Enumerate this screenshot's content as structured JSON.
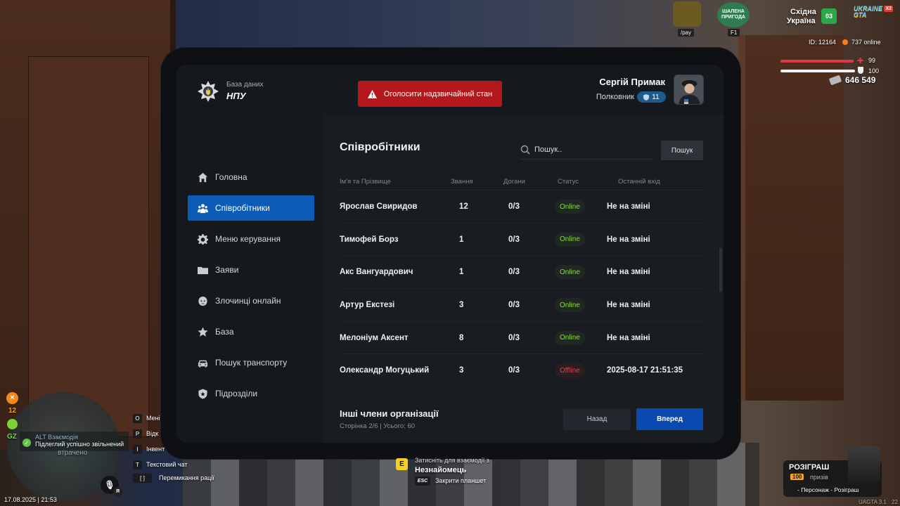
{
  "colors": {
    "accent": "#0a5cb7",
    "danger": "#b3191c",
    "online": "#8fd94a",
    "offline": "#e04349"
  },
  "header": {
    "db_subtitle": "База даних",
    "db_title": "НПУ",
    "emergency_label": "Оголосити надзвичайний стан",
    "user_name": "Сергій Примак",
    "user_rank": "Полковник",
    "rank_level": "11"
  },
  "sidebar": {
    "items": [
      {
        "label": "Головна",
        "icon": "home-icon"
      },
      {
        "label": "Співробітники",
        "icon": "users-icon",
        "active": true
      },
      {
        "label": "Меню керування",
        "icon": "gear-icon"
      },
      {
        "label": "Заяви",
        "icon": "folder-icon"
      },
      {
        "label": "Злочинці онлайн",
        "icon": "mask-icon"
      },
      {
        "label": "База",
        "icon": "star-icon"
      },
      {
        "label": "Пошук транспорту",
        "icon": "car-icon"
      },
      {
        "label": "Підрозділи",
        "icon": "shield-icon"
      }
    ]
  },
  "main": {
    "title": "Співробітники",
    "search_placeholder": "Пошук..",
    "search_button": "Пошук",
    "columns": [
      "Ім'я та Прізвище",
      "Звання",
      "Догани",
      "Статус",
      "Останній вхід"
    ],
    "rows": [
      {
        "name": "Ярослав Свиридов",
        "rank": "12",
        "reprimands": "0/3",
        "status": "Online",
        "last": "Не на зміні"
      },
      {
        "name": "Тимофей Борз",
        "rank": "1",
        "reprimands": "0/3",
        "status": "Online",
        "last": "Не на зміні"
      },
      {
        "name": "Акс Вангуардович",
        "rank": "1",
        "reprimands": "0/3",
        "status": "Online",
        "last": "Не на зміні"
      },
      {
        "name": "Артур Екстезі",
        "rank": "3",
        "reprimands": "0/3",
        "status": "Online",
        "last": "Не на зміні"
      },
      {
        "name": "Мелоніум Аксент",
        "rank": "8",
        "reprimands": "0/3",
        "status": "Online",
        "last": "Не на зміні"
      },
      {
        "name": "Олександр Могуцький",
        "rank": "3",
        "reprimands": "0/3",
        "status": "Offline",
        "last": "2025-08-17 21:51:35"
      }
    ],
    "footer_title": "Інші члени організації",
    "footer_sub": "Сторінка 2/6 | Усього: 60",
    "back_label": "Назад",
    "next_label": "Вперед"
  },
  "hud": {
    "region_line1": "Східна",
    "region_line2": "Україна",
    "region_number": "03",
    "server_logo": "UKRAINE GTA",
    "server_multiplier": "X2",
    "pay_label": "/pay",
    "event_label": "ШАЛЕНА ПРИГОДА",
    "event_key": "F1",
    "player_id": "ID: 12164",
    "online_count": "737 online",
    "health": "99",
    "armor": "100",
    "money": "646 549",
    "hunger": "12",
    "alt_hint": "ALT Взаємодія",
    "notification": "Підлеглий успішно звільнений",
    "lost_label": "втрачено",
    "gz_label": "GZ",
    "keys": [
      {
        "key": "O",
        "label": "Мені"
      },
      {
        "key": "P",
        "label": "Відк"
      },
      {
        "key": "I",
        "label": "Інвент"
      },
      {
        "key": "T",
        "label": "Текстовий чат"
      },
      {
        "key": "[ ]",
        "label": "Перемикання рації"
      }
    ],
    "interact_hint": "Затисніть для взаємодії з",
    "interact_key": "E",
    "interact_target": "Незнайомець",
    "esc_key": "ESC",
    "esc_hint": "Закрити планшет",
    "datetime": "17.08.2025 | 21:53",
    "mic_key": "Я",
    "giveaway_title": "РОЗІГРАШ",
    "giveaway_count": "100",
    "giveaway_unit": "призів",
    "giveaway_sub": "- Персонаж - Розіграш",
    "version": "UAGTA 3.1",
    "version_suffix": "22"
  }
}
